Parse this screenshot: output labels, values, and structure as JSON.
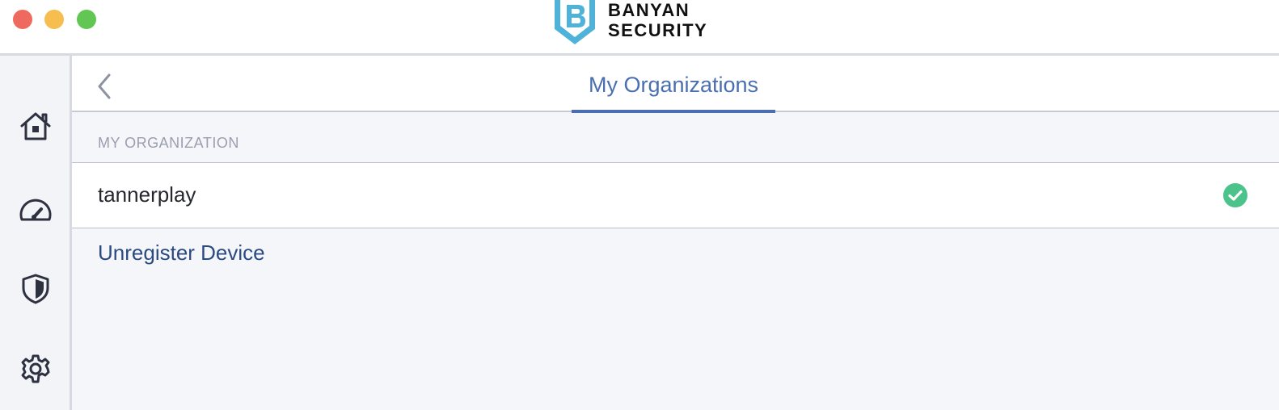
{
  "window": {
    "traffic_lights": [
      "close",
      "minimize",
      "maximize"
    ]
  },
  "brand": {
    "line1": "BANYAN",
    "line2": "SECURITY",
    "logo_icon": "banyan-shield-logo",
    "accent_color": "#4fb3d9"
  },
  "sidebar": {
    "items": [
      {
        "name": "home",
        "icon": "home-icon"
      },
      {
        "name": "dashboard",
        "icon": "speedometer-icon"
      },
      {
        "name": "security",
        "icon": "shield-icon"
      },
      {
        "name": "settings",
        "icon": "gear-icon"
      }
    ]
  },
  "header": {
    "back_icon": "chevron-left-icon",
    "tab_label": "My Organizations",
    "tab_color": "#4a6fb0"
  },
  "content": {
    "section_label": "MY ORGANIZATION",
    "organizations": [
      {
        "name": "tannerplay",
        "status_icon": "check-circle-icon",
        "status_color": "#4cc38a"
      }
    ],
    "unregister_label": "Unregister Device"
  }
}
